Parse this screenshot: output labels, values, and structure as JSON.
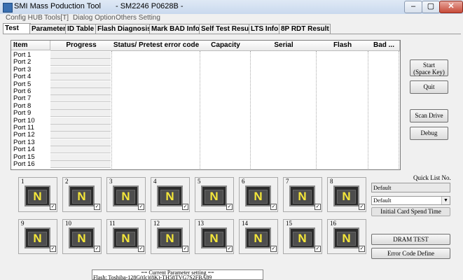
{
  "window": {
    "title": "SMI Mass Poduction Tool",
    "subtitle": "- SM2246 P0628B -",
    "minimize": "–",
    "maximize": "▢",
    "close": "✕"
  },
  "menu": [
    "Config HUB",
    "Tools[T]",
    "Dialog Option",
    "Others Setting"
  ],
  "tabs": [
    "Test",
    "Parameter",
    "ID Table",
    "Flash Diagnosis",
    "Mark BAD Info",
    "Self Test Result",
    "LTS Info",
    "8P RDT Result"
  ],
  "list": {
    "headers": [
      "Item",
      "Progress",
      "Status/ Pretest error code",
      "Capacity",
      "Serial",
      "Flash",
      "Bad ..."
    ],
    "rows": [
      "Port 1",
      "Port 2",
      "Port 3",
      "Port 4",
      "Port 5",
      "Port 6",
      "Port 7",
      "Port 8",
      "Port 9",
      "Port 10",
      "Port 11",
      "Port 12",
      "Port 13",
      "Port 14",
      "Port 15",
      "Port 16"
    ]
  },
  "buttons": {
    "start_line1": "Start",
    "start_line2": "(Space Key)",
    "quit": "Quit",
    "scan_drive": "Scan Drive",
    "debug": "Debug",
    "dram_test": "DRAM TEST",
    "error_code": "Error Code Define"
  },
  "ports": [
    {
      "num": "1",
      "label": "N"
    },
    {
      "num": "2",
      "label": "N"
    },
    {
      "num": "3",
      "label": "N"
    },
    {
      "num": "4",
      "label": "N"
    },
    {
      "num": "5",
      "label": "N"
    },
    {
      "num": "6",
      "label": "N"
    },
    {
      "num": "7",
      "label": "N"
    },
    {
      "num": "8",
      "label": "N"
    },
    {
      "num": "9",
      "label": "N"
    },
    {
      "num": "10",
      "label": "N"
    },
    {
      "num": "11",
      "label": "N"
    },
    {
      "num": "12",
      "label": "N"
    },
    {
      "num": "13",
      "label": "N"
    },
    {
      "num": "14",
      "label": "N"
    },
    {
      "num": "15",
      "label": "N"
    },
    {
      "num": "16",
      "label": "N"
    }
  ],
  "quick_list": {
    "label": "Quick List No.",
    "value": "Default",
    "select": "Default",
    "init_time_label": "Initial Card Spend Time"
  },
  "parameter": {
    "heading": "== Current Parameter setting ==",
    "flash": "Flash:    Toshiba-128G(tlc)(8K)-TH58TVG7S2FBA89"
  },
  "colors": {
    "accent": "#f5e73a",
    "tile": "#2b2b2b"
  }
}
